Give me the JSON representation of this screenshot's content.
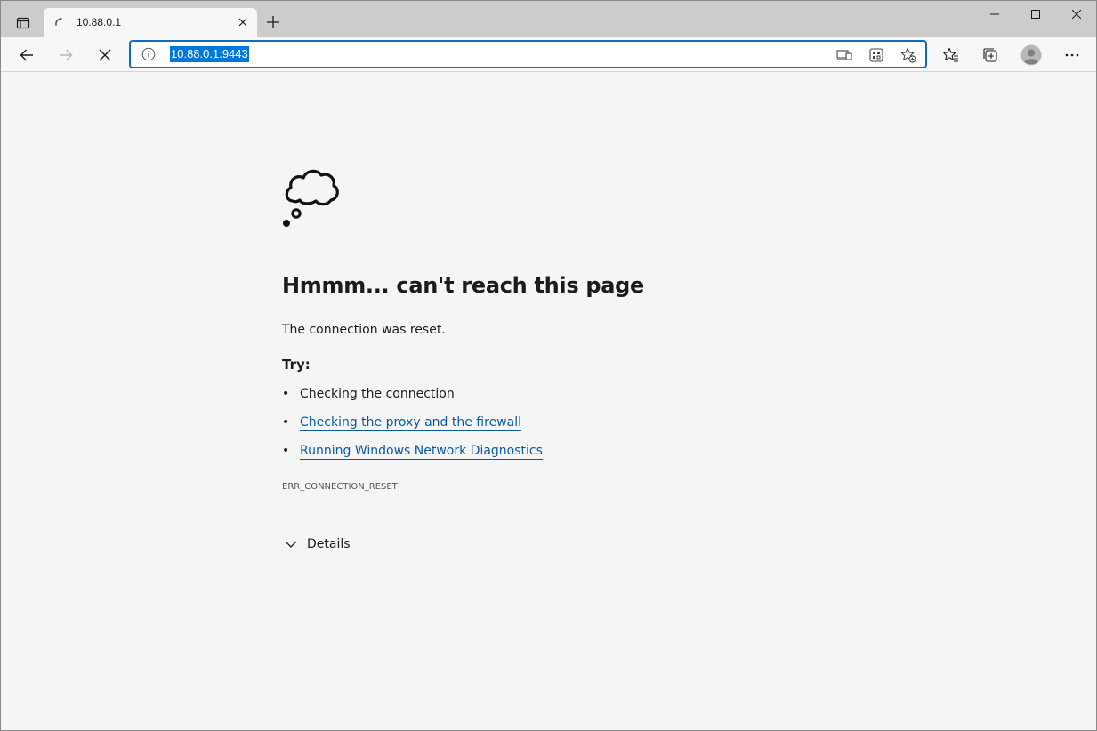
{
  "tab": {
    "title": "10.88.0.1",
    "close_icon": "close-icon",
    "loading_icon": "loading-spinner-icon"
  },
  "window_controls": [
    "minimize-icon",
    "maximize-icon",
    "close-icon"
  ],
  "toolbar": {
    "back_icon": "back-arrow-icon",
    "forward_icon": "forward-arrow-icon",
    "stop_icon": "stop-icon",
    "url": "10.88.0.1:9443",
    "address_icons": [
      "site-info-icon",
      "immersive-reader-icon",
      "apps-icon",
      "add-favorite-icon"
    ],
    "right_icons": [
      "favorites-icon",
      "collections-icon",
      "profile-icon",
      "more-icon"
    ]
  },
  "error_page": {
    "illustration": "thought-cloud-icon",
    "heading": "Hmmm... can't reach this page",
    "reason": "The connection was reset.",
    "try_label": "Try:",
    "suggestions": [
      {
        "text": "Checking the connection",
        "link": false
      },
      {
        "text": "Checking the proxy and the firewall",
        "link": true
      },
      {
        "text": "Running Windows Network Diagnostics",
        "link": true
      }
    ],
    "error_code": "ERR_CONNECTION_RESET",
    "details_label": "Details"
  },
  "colors": {
    "accent": "#0f6cbd",
    "selection": "#0078d7",
    "link": "#0c5a9e",
    "page_bg": "#f5f5f5",
    "tabstrip_bg": "#cccccc"
  }
}
